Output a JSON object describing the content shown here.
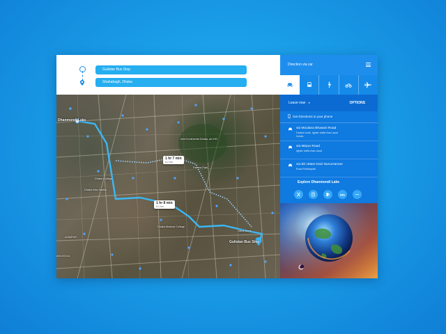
{
  "route": {
    "origin": "Gulistan Bus Stop",
    "destination": "Shahabagh, Dhaka"
  },
  "map": {
    "callouts": [
      {
        "time": "1 hr 7 min",
        "distance": "6.2 km"
      },
      {
        "time": "1 hr 8 min",
        "distance": "6.1 km"
      }
    ],
    "labels": {
      "dhanmondi": "Dhanmondi Lake",
      "gulistan": "Gulistan Bus Stop",
      "intercontinental": "InterContinental Dhaka, an IHG",
      "ramna": "Ramna Park",
      "dhaka_medical": "Dhaka Medical College",
      "dhaka_college": "Dhaka College",
      "new_market": "Dhaka New Market",
      "azimpur": "AZIMPUR",
      "office_bank": "Office Bank",
      "amligola": "AMLIGOLA"
    }
  },
  "panel": {
    "title": "Direction via car",
    "leave_label": "Leave now",
    "leave_caret": "▾",
    "options_label": "OPTIONS",
    "phone_label": "Get Directions to your phone",
    "routes": [
      {
        "via": "via Moulana Bhasani Road",
        "sub": "Fastest route, lighter traffic than usual",
        "sub2": "Details"
      },
      {
        "via": "via Mirpur Road",
        "sub": "lighter traffic than usual",
        "sub2": ""
      },
      {
        "via": "via Bir Uttam Kazi Nuruzzaman",
        "sub": "Road Panthapath",
        "sub2": ""
      }
    ],
    "explore_label": "Explore Dhanmondi Lake",
    "modes": [
      "car-icon",
      "bus-icon",
      "walk-icon",
      "motorbike-icon",
      "plane-icon"
    ],
    "explore_icons": [
      "restaurant-icon",
      "hotel-icon",
      "gas-station-icon",
      "bed-icon",
      "more-icon"
    ]
  },
  "colors": {
    "accent": "#25aef0",
    "panel": "#0f7ae0",
    "route_line": "#3ab8f5"
  }
}
